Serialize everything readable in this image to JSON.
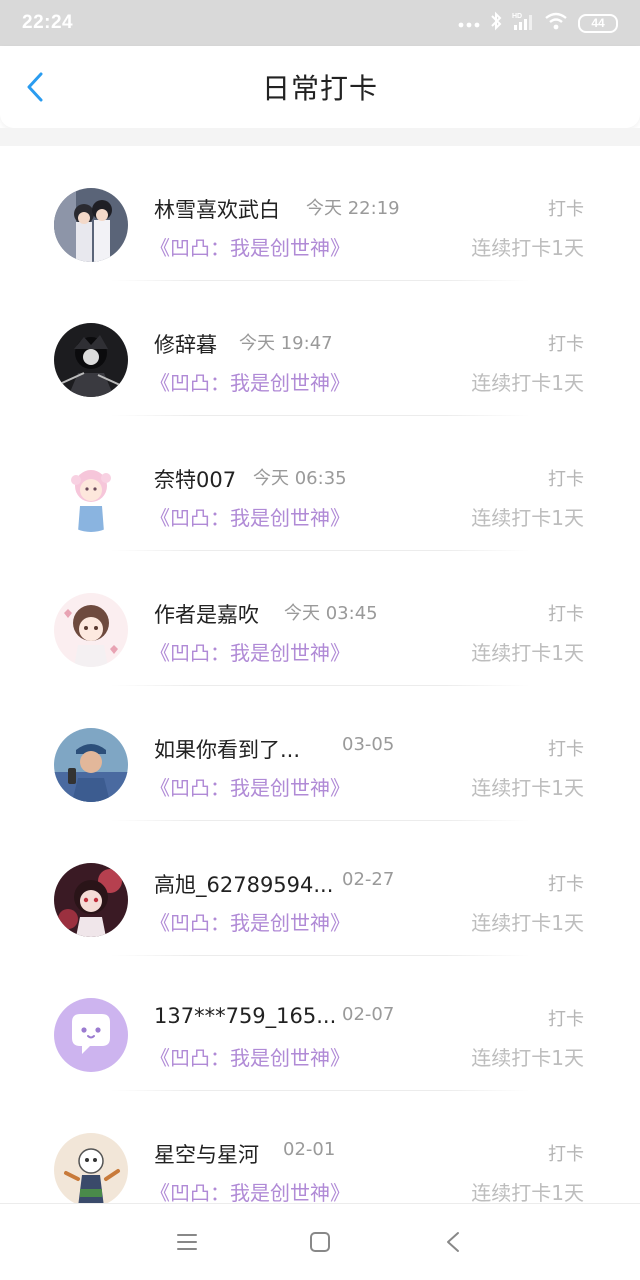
{
  "status_bar": {
    "time": "22:24",
    "battery": "44",
    "icons": [
      "more-dots-icon",
      "bluetooth-icon",
      "hd-signal-icon",
      "wifi-icon",
      "battery-icon"
    ]
  },
  "header": {
    "title": "日常打卡",
    "back_icon": "chevron-left-icon"
  },
  "colors": {
    "accent_blue": "#2a9cf0",
    "book_purple": "#b08ad6",
    "muted_gray": "#bdbdbd"
  },
  "checkins": [
    {
      "name": "林雪喜欢武白",
      "time": "今天 22:19",
      "tag": "打卡",
      "book": "《凹凸：我是创世神》",
      "streak": "连续打卡1天"
    },
    {
      "name": "修辞暮",
      "time": "今天 19:47",
      "tag": "打卡",
      "book": "《凹凸：我是创世神》",
      "streak": "连续打卡1天"
    },
    {
      "name": "奈特007",
      "time": "今天 06:35",
      "tag": "打卡",
      "book": "《凹凸：我是创世神》",
      "streak": "连续打卡1天"
    },
    {
      "name": "作者是嘉吹",
      "time": "今天 03:45",
      "tag": "打卡",
      "book": "《凹凸：我是创世神》",
      "streak": "连续打卡1天"
    },
    {
      "name": "如果你看到了...",
      "time": "03-05",
      "tag": "打卡",
      "book": "《凹凸：我是创世神》",
      "streak": "连续打卡1天"
    },
    {
      "name": "高旭_62789594...",
      "time": "02-27",
      "tag": "打卡",
      "book": "《凹凸：我是创世神》",
      "streak": "连续打卡1天"
    },
    {
      "name": "137***759_165...",
      "time": "02-07",
      "tag": "打卡",
      "book": "《凹凸：我是创世神》",
      "streak": "连续打卡1天"
    },
    {
      "name": "星空与星河",
      "time": "02-01",
      "tag": "打卡",
      "book": "《凹凸：我是创世神》",
      "streak": "连续打卡1天"
    }
  ],
  "nav_bar": {
    "icons": [
      "menu-icon",
      "home-square-icon",
      "back-triangle-icon"
    ]
  }
}
